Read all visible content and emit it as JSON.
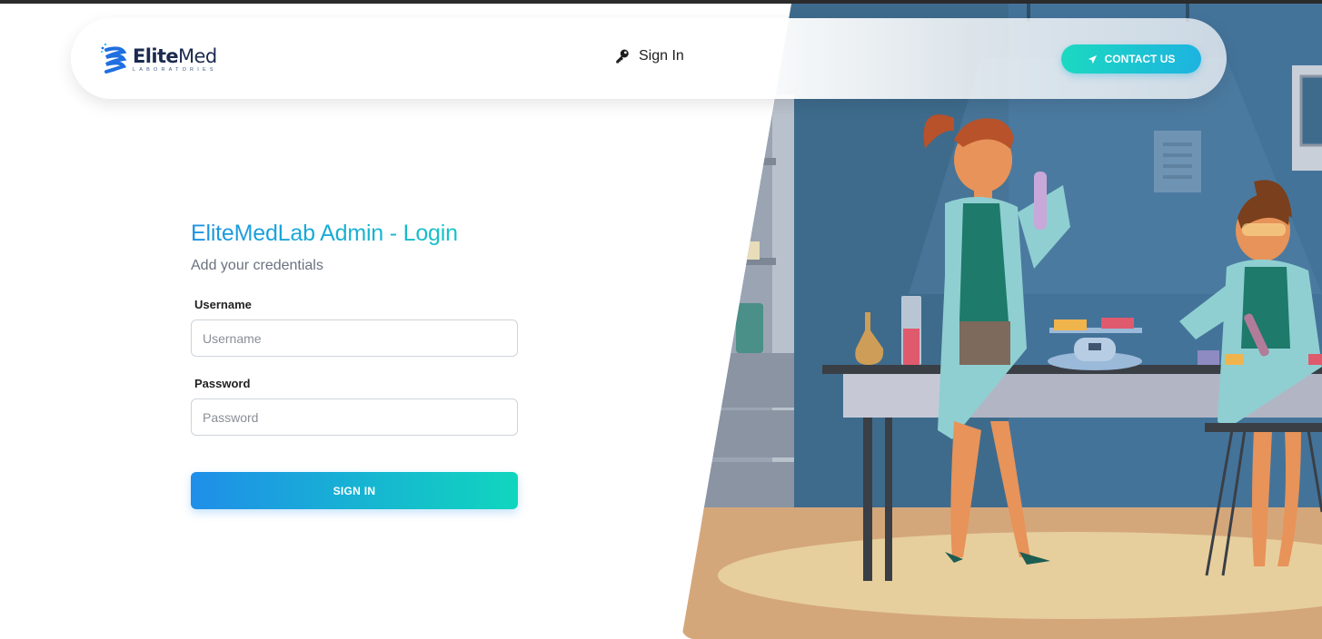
{
  "brand": {
    "name_bold": "Elite",
    "name_regular": "Med",
    "tagline": "LABORATORIES"
  },
  "nav": {
    "signin_label": "Sign In",
    "contact_label": "CONTACT US"
  },
  "login": {
    "title": "EliteMedLab Admin - Login",
    "subtitle": "Add your credentials",
    "username_label": "Username",
    "username_placeholder": "Username",
    "username_value": "",
    "password_label": "Password",
    "password_placeholder": "Password",
    "password_value": "",
    "submit_label": "SIGN IN"
  },
  "colors": {
    "accent_start": "#1f8ee9",
    "accent_end": "#10d6be",
    "brand_navy": "#1b2a4e"
  },
  "icons": {
    "nav_signin": "key-icon",
    "contact": "paper-plane-icon",
    "logo": "dna-helix-icon"
  }
}
